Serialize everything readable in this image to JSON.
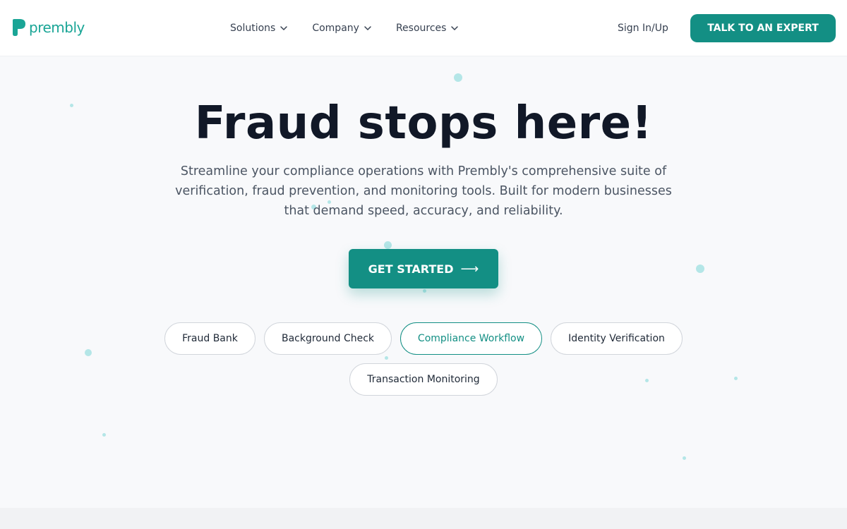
{
  "brand": {
    "name": "prembly",
    "accent": "#138f84",
    "logo_color": "#1aa596"
  },
  "nav": {
    "items": [
      {
        "label": "Solutions"
      },
      {
        "label": "Company"
      },
      {
        "label": "Resources"
      }
    ],
    "signin_label": "Sign In/Up",
    "cta_label": "TALK TO AN EXPERT"
  },
  "hero": {
    "title": "Fraud stops here!",
    "subtitle_lines": [
      "Streamline your compliance operations with Prembly's comprehensive suite of",
      "verification, fraud prevention, and monitoring tools. Built for modern businesses",
      "that demand speed, accuracy, and reliability."
    ],
    "cta_label": "GET STARTED",
    "cta_arrow": "⟶"
  },
  "pills": [
    {
      "label": "Fraud Bank",
      "active": false
    },
    {
      "label": "Background Check",
      "active": false
    },
    {
      "label": "Compliance Workflow",
      "active": true
    },
    {
      "label": "Identity Verification",
      "active": false
    },
    {
      "label": "Transaction Monitoring",
      "active": false
    }
  ]
}
